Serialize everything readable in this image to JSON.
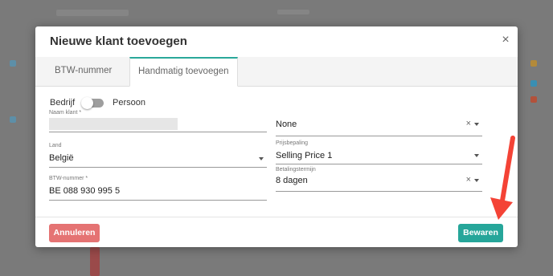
{
  "dialog": {
    "title": "Nieuwe klant toevoegen",
    "close_label": "×"
  },
  "tabs": [
    {
      "label": "BTW-nummer"
    },
    {
      "label": "Handmatig toevoegen"
    }
  ],
  "type_toggle": {
    "left_label": "Bedrijf",
    "right_label": "Persoon",
    "value": "Bedrijf"
  },
  "fields": {
    "name": {
      "label": "Naam klant *",
      "value": ""
    },
    "country": {
      "label": "Land",
      "value": "België"
    },
    "vat": {
      "label": "BTW-nummer *",
      "value": "BE 088 930 995 5"
    },
    "group": {
      "label": "",
      "value": "None"
    },
    "pricing": {
      "label": "Prijsbepaling",
      "value": "Selling Price 1"
    },
    "payment_term": {
      "label": "Betalingstermijn",
      "value": "8 dagen"
    }
  },
  "buttons": {
    "cancel": "Annuleren",
    "save": "Bewaren"
  },
  "colors": {
    "accent": "#26a69a",
    "danger": "#e57373",
    "annotation_arrow": "#f44336"
  },
  "icons": {
    "close": "close-icon",
    "dropdown": "chevron-down-icon",
    "clear": "clear-icon"
  }
}
